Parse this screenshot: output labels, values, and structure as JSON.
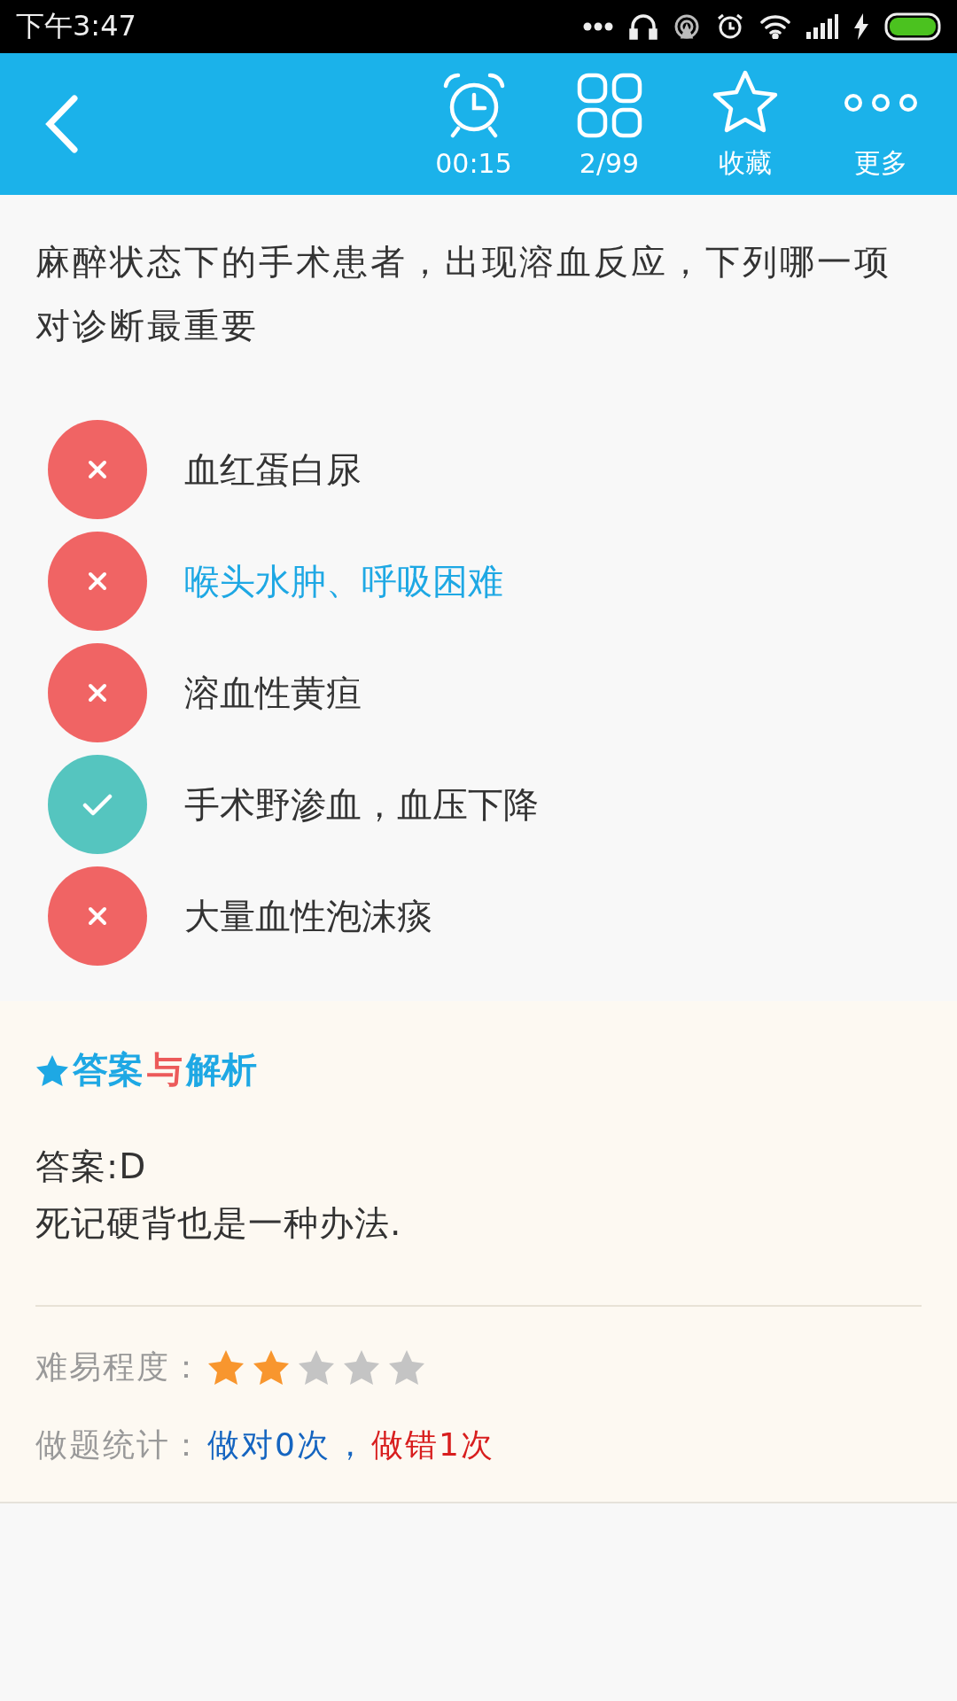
{
  "status_bar": {
    "time": "下午3:47"
  },
  "toolbar": {
    "items": [
      {
        "kind": "timer",
        "label": "00:15"
      },
      {
        "kind": "grid",
        "label": "2/99"
      },
      {
        "kind": "star",
        "label": "收藏"
      },
      {
        "kind": "more",
        "label": "更多"
      }
    ]
  },
  "question": "麻醉状态下的手术患者，出现溶血反应，下列哪一项对诊断最重要",
  "options": [
    {
      "text": "血红蛋白尿",
      "kind": "wrong",
      "selected": false
    },
    {
      "text": "喉头水肿、呼吸困难",
      "kind": "wrong",
      "selected": true
    },
    {
      "text": "溶血性黄疸",
      "kind": "wrong",
      "selected": false
    },
    {
      "text": "手术野渗血，血压下降",
      "kind": "correct",
      "selected": false
    },
    {
      "text": "大量血性泡沫痰",
      "kind": "wrong",
      "selected": false
    }
  ],
  "analysis": {
    "heading": [
      {
        "text": "答案",
        "color": "#1ea8e4"
      },
      {
        "text": "与",
        "color": "#ec5a5a"
      },
      {
        "text": "解析",
        "color": "#1ea8e4"
      }
    ],
    "answer": "答案:D",
    "explanation": "死记硬背也是一种办法.",
    "difficulty": {
      "label": "难易程度：",
      "stars": 2
    },
    "stats": {
      "label": "做题统计：",
      "correct": "做对0次",
      "separator": "，",
      "wrong": "做错1次"
    }
  }
}
